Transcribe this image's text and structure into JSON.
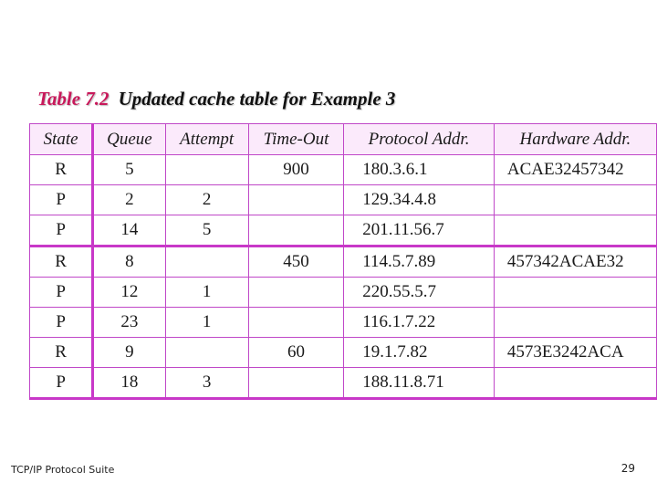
{
  "caption": {
    "number": "Table 7.2",
    "title": "Updated cache table for Example 3"
  },
  "table": {
    "headers": [
      "State",
      "Queue",
      "Attempt",
      "Time-Out",
      "Protocol Addr.",
      "Hardware Addr."
    ],
    "rows": [
      [
        "R",
        "5",
        "",
        "900",
        "180.3.6.1",
        "ACAE32457342"
      ],
      [
        "P",
        "2",
        "2",
        "",
        "129.34.4.8",
        ""
      ],
      [
        "P",
        "14",
        "5",
        "",
        "201.11.56.7",
        ""
      ],
      [
        "R",
        "8",
        "",
        "450",
        "114.5.7.89",
        "457342ACAE32"
      ],
      [
        "P",
        "12",
        "1",
        "",
        "220.55.5.7",
        ""
      ],
      [
        "P",
        "23",
        "1",
        "",
        "116.1.7.22",
        ""
      ],
      [
        "R",
        "9",
        "",
        "60",
        "19.1.7.82",
        "4573E3242ACA"
      ],
      [
        "P",
        "18",
        "3",
        "",
        "188.11.8.71",
        ""
      ]
    ]
  },
  "footer": {
    "left": "TCP/IP Protocol Suite",
    "page_number": "29"
  },
  "colors": {
    "caption_number": "#c8185a",
    "table_border": "#c048c8",
    "header_background": "#fbeafb"
  }
}
